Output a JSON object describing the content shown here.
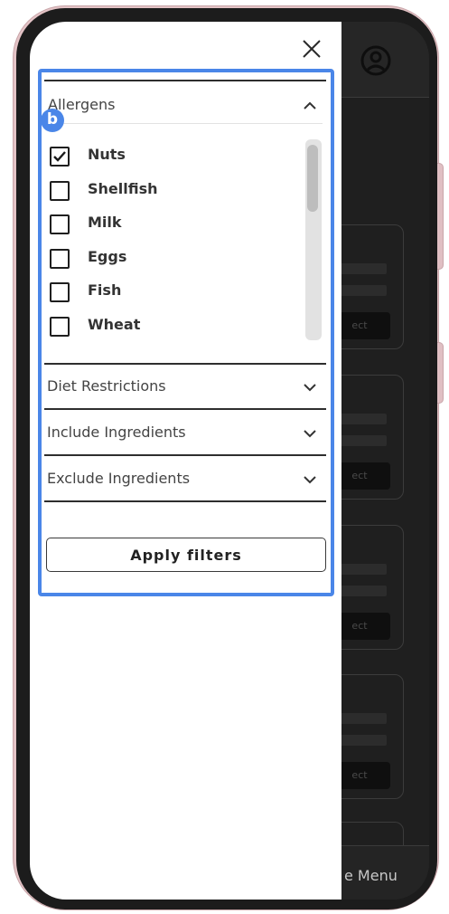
{
  "drawer": {
    "badge": "b",
    "sections": {
      "allergens": {
        "title": "Allergens",
        "expanded": true,
        "items": [
          {
            "label": "Nuts",
            "checked": true
          },
          {
            "label": "Shellfish",
            "checked": false
          },
          {
            "label": "Milk",
            "checked": false
          },
          {
            "label": "Eggs",
            "checked": false
          },
          {
            "label": "Fish",
            "checked": false
          },
          {
            "label": "Wheat",
            "checked": false
          }
        ]
      },
      "diet_restrictions": {
        "title": "Diet Restrictions",
        "expanded": false
      },
      "include_ingredients": {
        "title": "Include Ingredients",
        "expanded": false
      },
      "exclude_ingredients": {
        "title": "Exclude Ingredients",
        "expanded": false
      }
    },
    "apply_label": "Apply filters"
  },
  "background": {
    "card_button_text": "ect",
    "footer_text": "e Menu"
  },
  "colors": {
    "highlight": "#4a86e8",
    "backdrop": "#1f1f1f",
    "device_case": "#e3c3c6"
  },
  "icons": {
    "close": "close-icon",
    "profile": "user-circle-icon",
    "expand": "chevron-down-icon",
    "collapse": "chevron-up-icon",
    "checked": "checkmark-icon"
  }
}
